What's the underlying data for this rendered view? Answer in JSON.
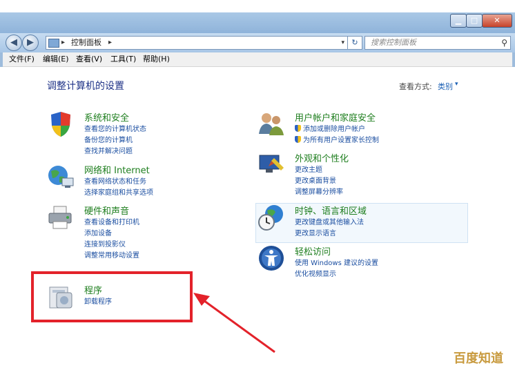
{
  "window": {
    "caption": {
      "minimize": "▁",
      "maximize": "□",
      "close": "✕"
    }
  },
  "nav": {
    "back_icon": "back-arrow-icon",
    "forward_icon": "forward-arrow-icon",
    "address_separator": "▸",
    "address": "控制面板",
    "address_dropdown": "▾",
    "refresh": "↻",
    "search_placeholder": "搜索控制面板",
    "search_icon": "⚲"
  },
  "menu": {
    "file": "文件(F)",
    "edit": "编辑(E)",
    "view": "查看(V)",
    "tools": "工具(T)",
    "help": "帮助(H)"
  },
  "main": {
    "title": "调整计算机的设置",
    "view_by_label": "查看方式:",
    "view_by_value": "类别",
    "view_by_arrow": "▾"
  },
  "categories": {
    "system": {
      "title": "系统和安全",
      "links": [
        "查看您的计算机状态",
        "备份您的计算机",
        "查找并解决问题"
      ]
    },
    "network": {
      "title": "网络和 Internet",
      "links": [
        "查看网络状态和任务",
        "选择家庭组和共享选项"
      ]
    },
    "hardware": {
      "title": "硬件和声音",
      "links": [
        "查看设备和打印机",
        "添加设备",
        "连接到投影仪",
        "调整常用移动设置"
      ]
    },
    "programs": {
      "title": "程序",
      "links": [
        "卸载程序"
      ]
    },
    "users": {
      "title": "用户帐户和家庭安全",
      "links": [
        "添加或删除用户帐户",
        "为所有用户设置家长控制"
      ]
    },
    "appearance": {
      "title": "外观和个性化",
      "links": [
        "更改主题",
        "更改桌面背景",
        "调整屏幕分辨率"
      ]
    },
    "clock": {
      "title": "时钟、语言和区域",
      "links": [
        "更改键盘或其他输入法",
        "更改显示语言"
      ]
    },
    "ease": {
      "title": "轻松访问",
      "links": [
        "使用 Windows 建议的设置",
        "优化视频显示"
      ]
    }
  },
  "watermark": "百度知道"
}
